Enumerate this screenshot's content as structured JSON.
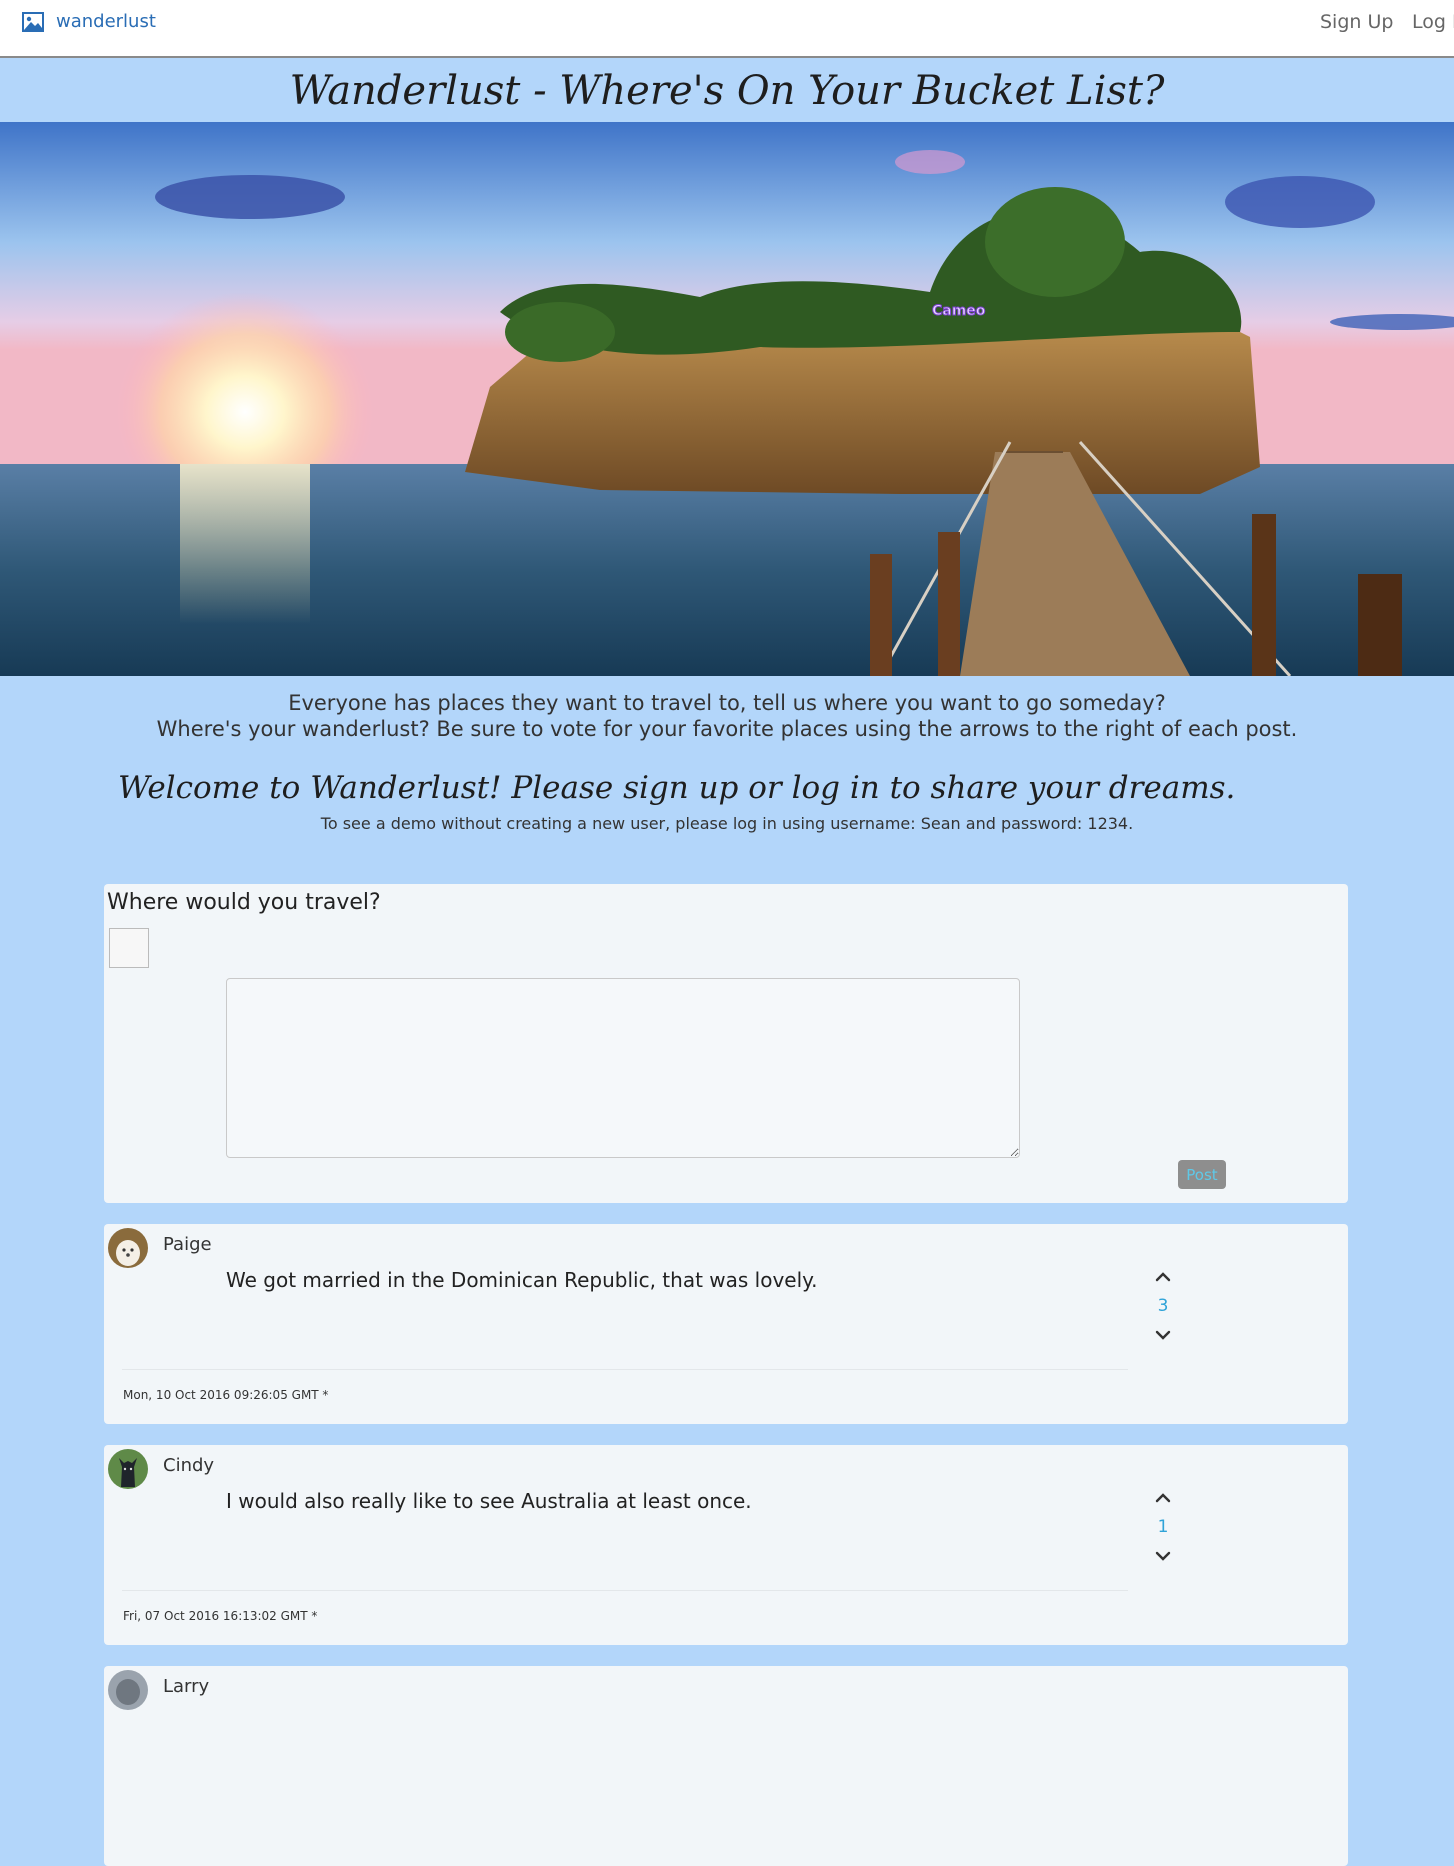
{
  "navbar": {
    "brand_label": "wanderlust",
    "brand_icon": "image-icon",
    "signup_label": "Sign Up",
    "login_label": "Log In"
  },
  "page": {
    "title": "Wanderlust - Where's On Your Bucket List?",
    "intro_line1": "Everyone has places they want to travel to, tell us where you want to go someday?",
    "intro_line2": "Where's your wanderlust? Be sure to vote for your favorite places using the arrows to the right of each post.",
    "welcome": "Welcome to Wanderlust! Please sign up or log in to share your dreams.",
    "demo_note": "To see a demo without creating a new user, please log in using username: Sean and password: 1234."
  },
  "hero": {
    "overlay_text": "Cameo"
  },
  "compose": {
    "title": "Where would you travel?",
    "textarea_value": "",
    "post_label": "Post"
  },
  "posts": [
    {
      "author": "Paige",
      "text": "We got married in the Dominican Republic, that was lovely.",
      "votes": "3",
      "date": "Mon, 10 Oct 2016 09:26:05 GMT *"
    },
    {
      "author": "Cindy",
      "text": "I would also really like to see Australia at least once.",
      "votes": "1",
      "date": "Fri, 07 Oct 2016 16:13:02 GMT *"
    },
    {
      "author": "Larry"
    }
  ],
  "colors": {
    "background": "#b3d6fa",
    "panel": "#f2f6f9",
    "brand": "#2a6db5",
    "vote_count": "#2fa3d8",
    "post_button_bg": "#8e8e8e",
    "post_button_text": "#5ec9e8"
  }
}
